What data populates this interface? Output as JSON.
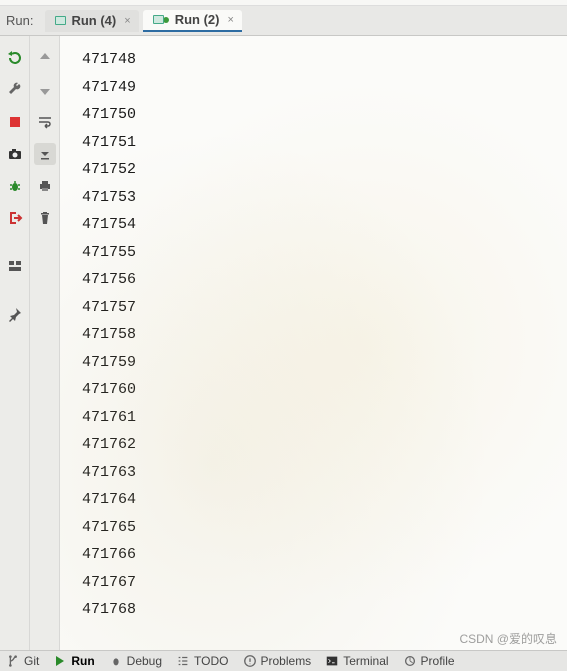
{
  "topbar": {
    "label": "Run:",
    "tabs": [
      {
        "label": "Run (4)",
        "active": false
      },
      {
        "label": "Run (2)",
        "active": true
      }
    ]
  },
  "toolbar_a": {
    "rerun": "rerun-icon",
    "wrench": "wrench-icon",
    "stop": "stop-icon",
    "camera": "camera-icon",
    "bug": "bug-icon",
    "exit": "exit-icon",
    "layout": "layout-icon",
    "pin": "pin-icon"
  },
  "toolbar_b": {
    "up": "arrow-up-icon",
    "down": "arrow-down-icon",
    "wrap": "wrap-icon",
    "scroll": "scroll-to-end-icon",
    "print": "print-icon",
    "trash": "trash-icon"
  },
  "output": {
    "lines": [
      "471748",
      "471749",
      "471750",
      "471751",
      "471752",
      "471753",
      "471754",
      "471755",
      "471756",
      "471757",
      "471758",
      "471759",
      "471760",
      "471761",
      "471762",
      "471763",
      "471764",
      "471765",
      "471766",
      "471767",
      "471768"
    ]
  },
  "bottombar": {
    "items": [
      {
        "label": "Git",
        "icon": "branch-icon"
      },
      {
        "label": "Run",
        "icon": "play-icon",
        "active": true
      },
      {
        "label": "Debug",
        "icon": "bug-icon"
      },
      {
        "label": "TODO",
        "icon": "todo-icon"
      },
      {
        "label": "Problems",
        "icon": "problems-icon"
      },
      {
        "label": "Terminal",
        "icon": "terminal-icon"
      },
      {
        "label": "Profile",
        "icon": "profile-icon"
      }
    ]
  },
  "watermark": "CSDN @爱的叹息"
}
